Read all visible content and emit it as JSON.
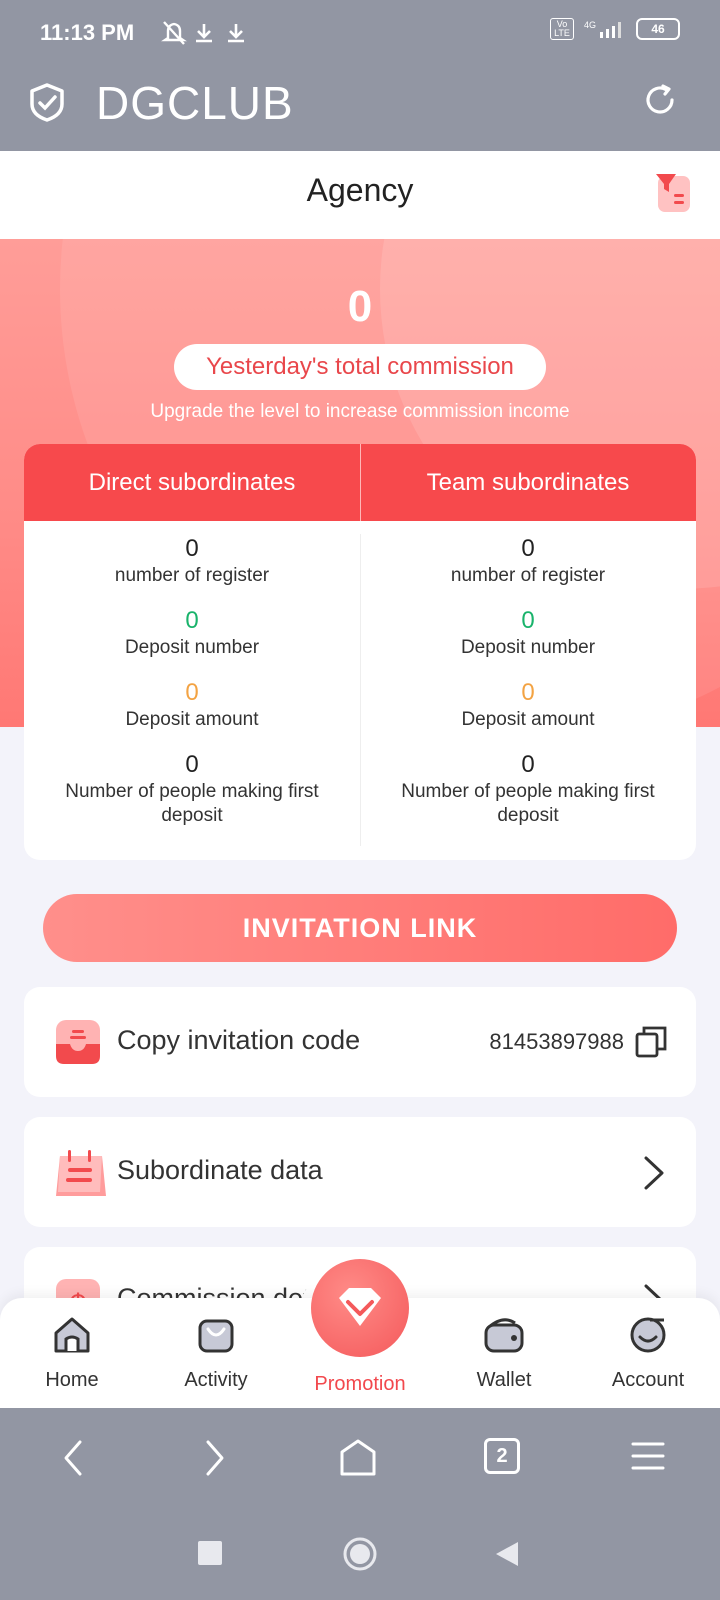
{
  "status_bar": {
    "time": "11:13 PM",
    "network": "4G",
    "volte": "Vo LTE",
    "battery": "46"
  },
  "app_bar": {
    "title": "DGCLUB"
  },
  "page": {
    "title": "Agency"
  },
  "hero": {
    "commission_value": "0",
    "commission_label": "Yesterday's total commission",
    "upgrade_text": "Upgrade the level to increase commission income"
  },
  "stats": {
    "direct_header": "Direct subordinates",
    "team_header": "Team subordinates",
    "direct": {
      "register_value": "0",
      "register_label": "number of register",
      "deposit_number_value": "0",
      "deposit_number_label": "Deposit number",
      "deposit_amount_value": "0",
      "deposit_amount_label": "Deposit amount",
      "first_deposit_value": "0",
      "first_deposit_label": "Number of people making first deposit"
    },
    "team": {
      "register_value": "0",
      "register_label": "number of register",
      "deposit_number_value": "0",
      "deposit_number_label": "Deposit number",
      "deposit_amount_value": "0",
      "deposit_amount_label": "Deposit amount",
      "first_deposit_value": "0",
      "first_deposit_label": "Number of people making first deposit"
    }
  },
  "invitation_button": "INVITATION LINK",
  "list": {
    "copy_code_label": "Copy invitation code",
    "invitation_code": "81453897988",
    "subordinate_data_label": "Subordinate data",
    "commission_detail_label": "Commission det"
  },
  "bottom_nav": {
    "home": "Home",
    "activity": "Activity",
    "promotion": "Promotion",
    "wallet": "Wallet",
    "account": "Account"
  },
  "browser_bar": {
    "tabs_count": "2"
  },
  "colors": {
    "accent": "#f7494c",
    "green": "#19b36b",
    "orange": "#f3a343",
    "chrome": "#9296a3"
  }
}
